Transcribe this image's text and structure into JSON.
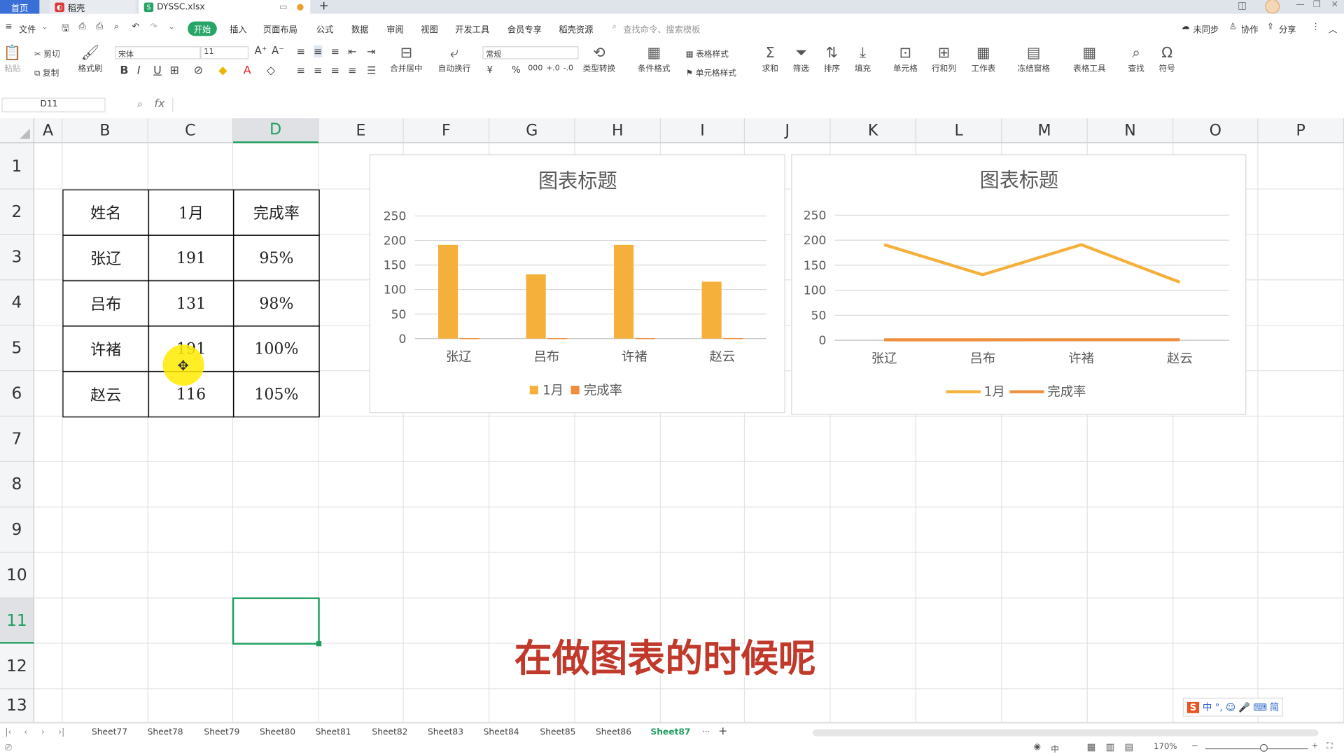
{
  "titlebar": {
    "home_tab": "首页",
    "docer_tab": "稻壳",
    "file_tab": "DYSSC.xlsx",
    "new_tab_plus": "+"
  },
  "menu": {
    "file": "文件",
    "items": [
      "开始",
      "插入",
      "页面布局",
      "公式",
      "数据",
      "审阅",
      "视图",
      "开发工具",
      "会员专享",
      "稻壳资源"
    ],
    "search_placeholder": "查找命令、搜索模板",
    "sync": "未同步",
    "collab": "协作",
    "share": "分享"
  },
  "toolbar": {
    "paste": "粘贴",
    "cut": "剪切",
    "copy": "复制",
    "format_painter": "格式刷",
    "font_name": "宋体",
    "font_size": "11",
    "merge": "合并居中",
    "wrap": "自动换行",
    "number_format": "常规",
    "type_convert": "类型转换",
    "cond_format": "条件格式",
    "table_style": "表格样式",
    "cell_style": "单元格样式",
    "sum": "求和",
    "filter": "筛选",
    "sort": "排序",
    "fill": "填充",
    "cell": "单元格",
    "row_col": "行和列",
    "worksheet": "工作表",
    "freeze": "冻结窗格",
    "table_tools": "表格工具",
    "find": "查找",
    "symbol": "符号"
  },
  "formula_bar": {
    "name_box": "D11",
    "fx": "fx",
    "formula": ""
  },
  "columns": [
    "A",
    "B",
    "C",
    "D",
    "E",
    "F",
    "G",
    "H",
    "I",
    "J",
    "K",
    "L",
    "M",
    "N",
    "O",
    "P"
  ],
  "rows": [
    "1",
    "2",
    "3",
    "4",
    "5",
    "6",
    "7",
    "8",
    "9",
    "10",
    "11",
    "12",
    "13"
  ],
  "selected_cell": "D11",
  "table": {
    "headers": [
      "姓名",
      "1月",
      "完成率"
    ],
    "rows": [
      [
        "张辽",
        "191",
        "95%"
      ],
      [
        "吕布",
        "131",
        "98%"
      ],
      [
        "许褚",
        "191",
        "100%"
      ],
      [
        "赵云",
        "116",
        "105%"
      ]
    ]
  },
  "chart_data": [
    {
      "type": "bar",
      "title": "图表标题",
      "categories": [
        "张辽",
        "吕布",
        "许褚",
        "赵云"
      ],
      "series": [
        {
          "name": "1月",
          "values": [
            191,
            131,
            191,
            116
          ],
          "color": "#f5b03b"
        },
        {
          "name": "完成率",
          "values": [
            0.95,
            0.98,
            1.0,
            1.05
          ],
          "color": "#ee8f3f"
        }
      ],
      "yticks": [
        "0",
        "50",
        "100",
        "150",
        "200",
        "250"
      ],
      "ylim": [
        0,
        250
      ],
      "grid": true,
      "legend": "bottom"
    },
    {
      "type": "line",
      "title": "图表标题",
      "categories": [
        "张辽",
        "吕布",
        "许褚",
        "赵云"
      ],
      "series": [
        {
          "name": "1月",
          "values": [
            191,
            131,
            191,
            116
          ],
          "color": "#f5b03b"
        },
        {
          "name": "完成率",
          "values": [
            0.95,
            0.98,
            1.0,
            1.05
          ],
          "color": "#ee8f3f"
        }
      ],
      "yticks": [
        "0",
        "50",
        "100",
        "150",
        "200",
        "250"
      ],
      "ylim": [
        0,
        250
      ],
      "grid": true,
      "legend": "bottom"
    }
  ],
  "sheets": {
    "tabs": [
      "Sheet77",
      "Sheet78",
      "Sheet79",
      "Sheet80",
      "Sheet81",
      "Sheet82",
      "Sheet83",
      "Sheet84",
      "Sheet85",
      "Sheet86",
      "Sheet87"
    ],
    "active": "Sheet87",
    "more": "···",
    "add": "+"
  },
  "status": {
    "zoom": "170%",
    "input_method": "中"
  },
  "subtitle": "在做图表的时候呢",
  "ime_bar": "中 °, ☺ 🎤 ⌨ 简"
}
